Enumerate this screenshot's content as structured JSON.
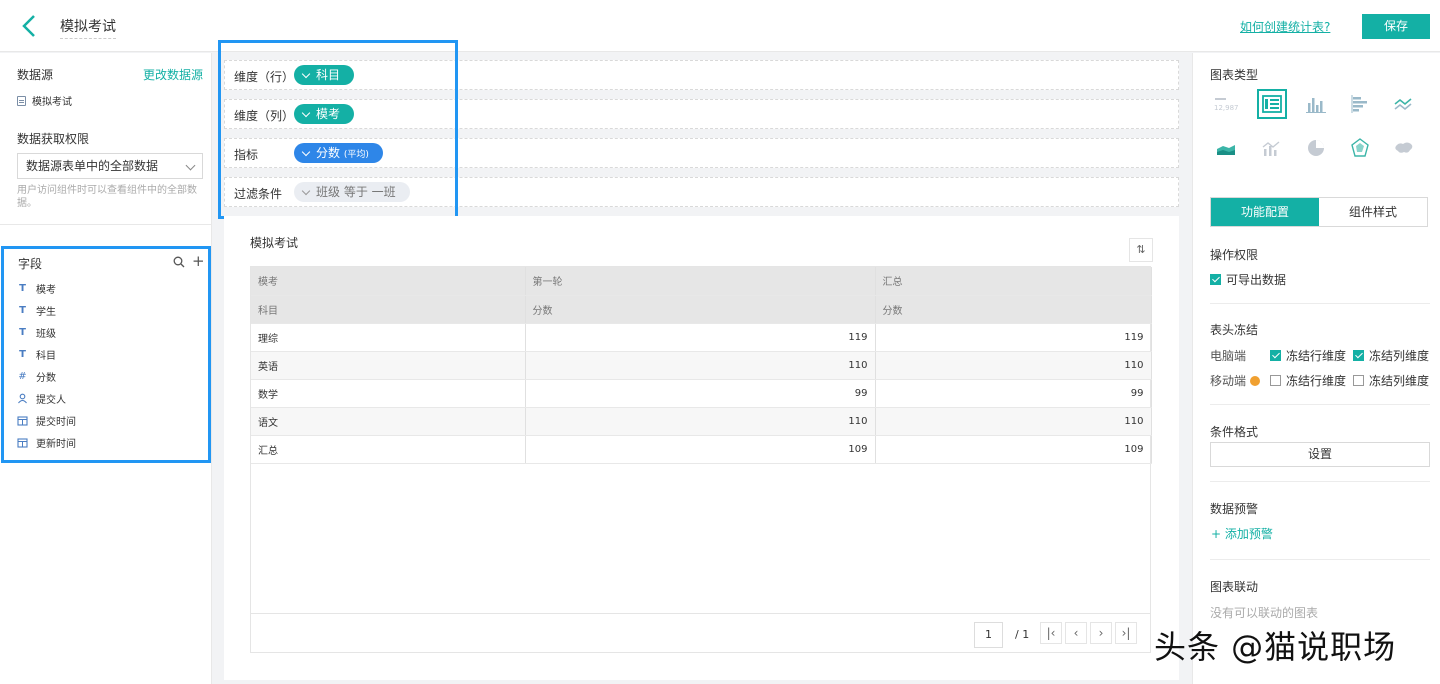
{
  "header": {
    "title": "模拟考试",
    "help_link": "如何创建统计表?",
    "save_label": "保存"
  },
  "left": {
    "datasource_label": "数据源",
    "change_datasource": "更改数据源",
    "datasource_name": "模拟考试",
    "permission_label": "数据获取权限",
    "permission_value": "数据源表单中的全部数据",
    "permission_hint": "用户访问组件时可以查看组件中的全部数据。",
    "fields_label": "字段",
    "fields": [
      {
        "type": "text",
        "icon": "T",
        "label": "模考"
      },
      {
        "type": "text",
        "icon": "T",
        "label": "学生"
      },
      {
        "type": "text",
        "icon": "T",
        "label": "班级"
      },
      {
        "type": "text",
        "icon": "T",
        "label": "科目"
      },
      {
        "type": "number",
        "icon": "#",
        "label": "分数"
      },
      {
        "type": "user",
        "icon": "user-icon",
        "label": "提交人"
      },
      {
        "type": "date",
        "icon": "calendar-icon",
        "label": "提交时间"
      },
      {
        "type": "date",
        "icon": "calendar-icon",
        "label": "更新时间"
      }
    ]
  },
  "config": {
    "row_dim_label": "维度（行）",
    "row_dim_value": "科目",
    "col_dim_label": "维度（列）",
    "col_dim_value": "模考",
    "metric_label": "指标",
    "metric_value": "分数",
    "metric_agg": "(平均)",
    "filter_label": "过滤条件",
    "filter_value": "班级 等于 一班"
  },
  "table": {
    "title": "模拟考试",
    "header_row1": [
      "模考",
      "第一轮",
      "汇总"
    ],
    "header_row2": [
      "科目",
      "分数",
      "分数"
    ],
    "rows": [
      [
        "理综",
        "119",
        "119"
      ],
      [
        "英语",
        "110",
        "110"
      ],
      [
        "数学",
        "99",
        "99"
      ],
      [
        "语文",
        "110",
        "110"
      ],
      [
        "汇总",
        "109",
        "109"
      ]
    ],
    "page_current": "1",
    "page_total": "/ 1"
  },
  "right": {
    "chart_type_label": "图表类型",
    "chart_types": [
      "indicator-card-icon",
      "table-icon",
      "column-chart-icon",
      "bar-chart-icon",
      "line-chart-icon",
      "area-chart-icon",
      "combo-chart-icon",
      "pie-chart-icon",
      "radar-chart-icon",
      "map-chart-icon"
    ],
    "indicator_number": "12,987",
    "tab_function": "功能配置",
    "tab_style": "组件样式",
    "op_perm_label": "操作权限",
    "export_label": "可导出数据",
    "freeze_label": "表头冻结",
    "pc_label": "电脑端",
    "mobile_label": "移动端",
    "freeze_row": "冻结行维度",
    "freeze_col": "冻结列维度",
    "cond_format_label": "条件格式",
    "set_label": "设置",
    "data_warn_label": "数据预警",
    "add_warn_label": "+ 添加预警",
    "linkage_label": "图表联动",
    "no_linkage": "没有可以联动的图表"
  },
  "watermark": "头条 @猫说职场",
  "colors": {
    "accent": "#14b0a5",
    "metric_pill": "#2e86e8",
    "highlight": "#2196f3"
  }
}
